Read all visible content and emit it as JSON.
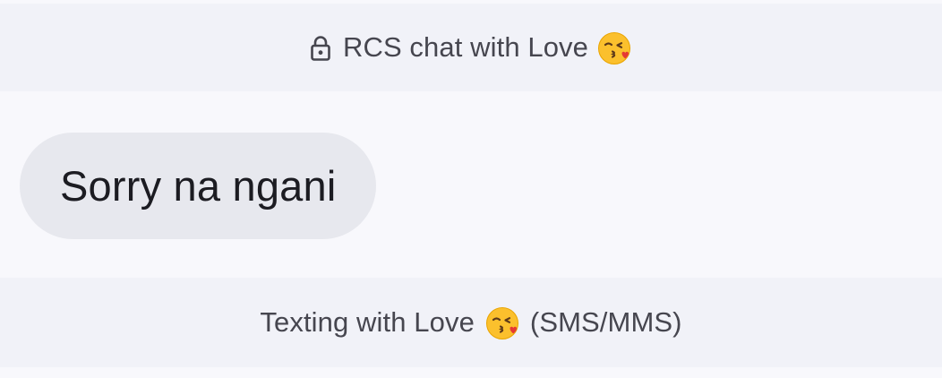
{
  "conversation": {
    "header_banner": {
      "prefix_text": "RCS chat with Love",
      "icon": "lock-icon",
      "emoji": "kissing-face-emoji"
    },
    "messages": [
      {
        "direction": "incoming",
        "text": "Sorry na ngani"
      }
    ],
    "footer_banner": {
      "prefix_text": "Texting with Love",
      "emoji": "kissing-face-emoji",
      "suffix_text": "(SMS/MMS)"
    }
  },
  "colors": {
    "background": "#f8f8fc",
    "banner_background": "#f1f2f8",
    "bubble_background": "#e7e8ee",
    "banner_text": "#46464f",
    "message_text": "#1c1c22"
  }
}
